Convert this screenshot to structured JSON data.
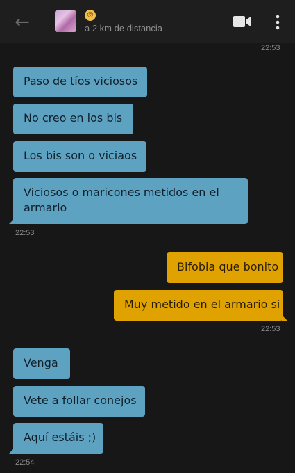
{
  "header": {
    "back_icon": "←",
    "emoji": "😚",
    "distance": "a 2 km de distancia"
  },
  "timestamps": {
    "top": "22:53",
    "group1": "22:53",
    "group2": "22:53",
    "group3": "22:54"
  },
  "messages": [
    {
      "side": "in",
      "text": "Paso de tíos viciosos"
    },
    {
      "side": "in",
      "text": "No creo en los bis"
    },
    {
      "side": "in",
      "text": "Los bis son o viciaos"
    },
    {
      "side": "in",
      "text": "Viciosos o maricones metidos en el armario"
    },
    {
      "side": "out",
      "text": "Bifobia que bonito"
    },
    {
      "side": "out",
      "text": "Muy metido en el armario si"
    },
    {
      "side": "in",
      "text": "Venga"
    },
    {
      "side": "in",
      "text": "Vete a follar conejos"
    },
    {
      "side": "in",
      "text": "Aquí estáis ;)"
    }
  ],
  "colors": {
    "incoming": "#5ea2c2",
    "outgoing": "#e0a200",
    "background": "#171717"
  }
}
